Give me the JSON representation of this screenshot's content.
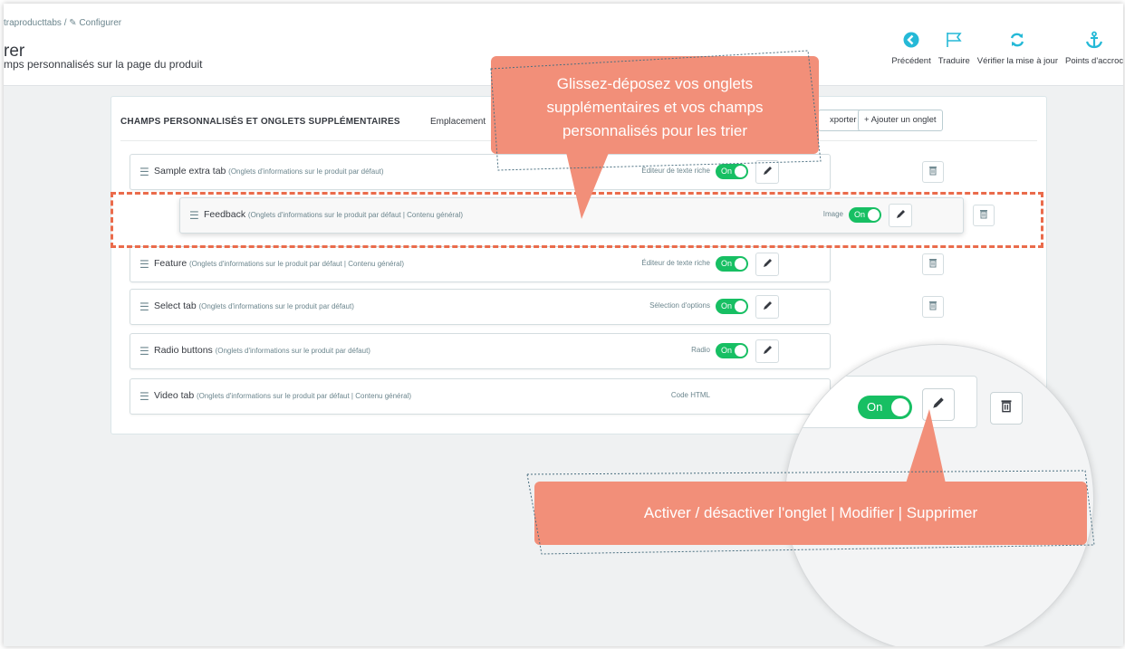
{
  "header": {
    "breadcrumb": "traproducttabs  /  ✎ Configurer",
    "title": "rer",
    "subtitle": "mps personnalisés sur la page du produit",
    "toolbar": [
      {
        "label": "Précédent",
        "icon": "back-circle-icon"
      },
      {
        "label": "Traduire",
        "icon": "flag-icon"
      },
      {
        "label": "Vérifier la mise à jour",
        "icon": "refresh-icon"
      },
      {
        "label": "Points d'accroc",
        "icon": "anchor-icon"
      }
    ]
  },
  "panel": {
    "title": "CHAMPS PERSONNALISÉS ET ONGLETS SUPPLÉMENTAIRES",
    "location_label": "Emplacement",
    "export_label": "xporter",
    "add_label": "+ Ajouter un onglet"
  },
  "rows": [
    {
      "name": "Sample extra tab",
      "desc": "(Onglets d'informations sur le produit par défaut)",
      "type": "Éditeur de texte riche",
      "toggle": "On"
    },
    {
      "name": "Feedback",
      "desc": "(Onglets d'informations sur le produit par défaut | Contenu général)",
      "type": "Image",
      "toggle": "On"
    },
    {
      "name": "Feature",
      "desc": "(Onglets d'informations sur le produit par défaut | Contenu général)",
      "type": "Éditeur de texte riche",
      "toggle": "On"
    },
    {
      "name": "Select tab",
      "desc": "(Onglets d'informations sur le produit par défaut)",
      "type": "Sélection d'options",
      "toggle": "On"
    },
    {
      "name": "Radio buttons",
      "desc": "(Onglets d'informations sur le produit par défaut)",
      "type": "Radio",
      "toggle": "On"
    },
    {
      "name": "Video tab",
      "desc": "(Onglets d'informations sur le produit par défaut | Contenu général)",
      "type": "Code HTML",
      "toggle": "On"
    }
  ],
  "callouts": {
    "drag_line1": "Glissez-déposez vos onglets",
    "drag_line2": "supplémentaires et vos champs",
    "drag_line3": "personnalisés pour les trier",
    "actions": "Activer / désactiver l'onglet | Modifier | Supprimer"
  },
  "magnifier": {
    "toggle": "On"
  },
  "colors": {
    "accent": "#17bf63",
    "callout": "#f28f79",
    "dashed": "#ea6b4b"
  }
}
